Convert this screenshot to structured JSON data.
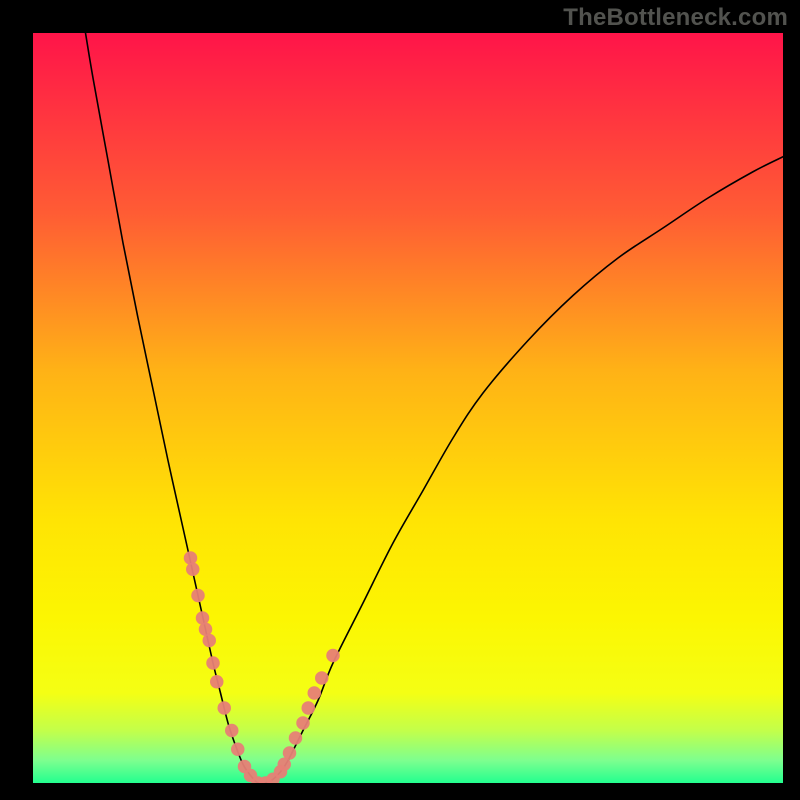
{
  "watermark": "TheBottleneck.com",
  "chart_data": {
    "type": "line",
    "title": "",
    "xlabel": "",
    "ylabel": "",
    "xlim": [
      0,
      100
    ],
    "ylim": [
      0,
      100
    ],
    "gradient_stops": [
      {
        "y": 100,
        "color": "#ff1449"
      },
      {
        "y": 76,
        "color": "#ff5c34"
      },
      {
        "y": 55,
        "color": "#ffb216"
      },
      {
        "y": 35,
        "color": "#ffe404"
      },
      {
        "y": 22,
        "color": "#fcf602"
      },
      {
        "y": 12,
        "color": "#f4ff14"
      },
      {
        "y": 7,
        "color": "#c3ff4a"
      },
      {
        "y": 3,
        "color": "#7dff8f"
      },
      {
        "y": 0,
        "color": "#23ff8f"
      }
    ],
    "series": [
      {
        "name": "curve",
        "x": [
          7,
          8,
          10,
          12,
          14,
          16,
          18,
          20,
          21,
          22,
          23,
          24,
          25,
          26,
          27,
          28,
          29,
          30,
          31,
          32,
          33,
          34,
          36,
          38,
          40,
          44,
          48,
          52,
          56,
          60,
          66,
          72,
          78,
          84,
          90,
          96,
          100
        ],
        "values": [
          100,
          94,
          83,
          72,
          62,
          52.5,
          43,
          34,
          29.5,
          25,
          20.5,
          16,
          12,
          8,
          5,
          2.5,
          1,
          0,
          0,
          0.5,
          1.5,
          3,
          7,
          11,
          16,
          24,
          32,
          39,
          46,
          52,
          59,
          65,
          70,
          74,
          78,
          81.5,
          83.5
        ]
      },
      {
        "name": "dots",
        "x": [
          21,
          21.3,
          22,
          22.6,
          23,
          23.5,
          24,
          24.5,
          25.5,
          26.5,
          27.3,
          28.2,
          29,
          30,
          31,
          32,
          33,
          33.5,
          34.2,
          35,
          36,
          36.7,
          37.5,
          38.5,
          40
        ],
        "values": [
          30,
          28.5,
          25,
          22,
          20.5,
          19,
          16,
          13.5,
          10,
          7,
          4.5,
          2.2,
          1,
          0,
          0,
          0.5,
          1.5,
          2.5,
          4,
          6,
          8,
          10,
          12,
          14,
          17
        ]
      }
    ]
  }
}
